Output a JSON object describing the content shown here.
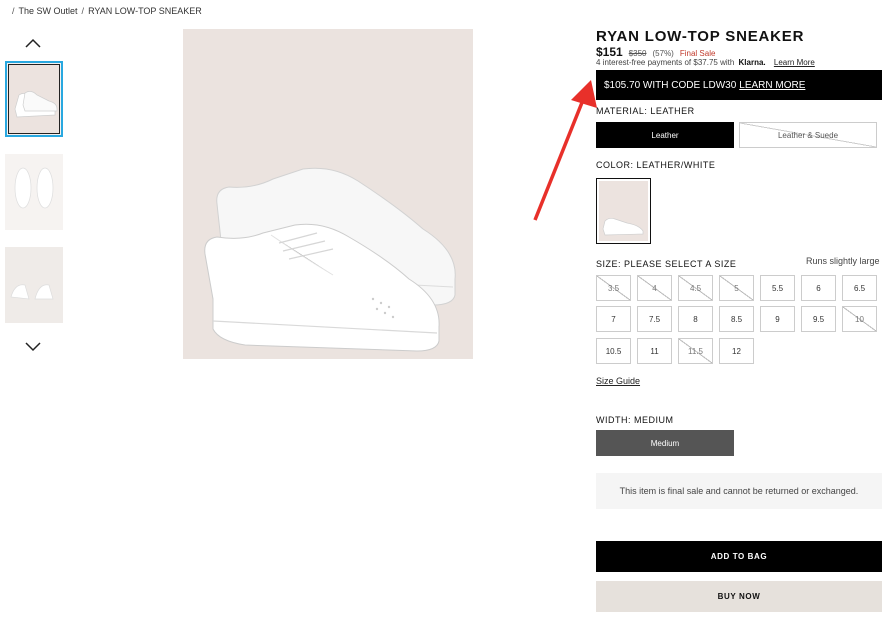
{
  "breadcrumb": {
    "items": [
      "The SW Outlet",
      "RYAN LOW-TOP SNEAKER"
    ]
  },
  "gallery": {
    "thumbnails": [
      "thumbnail-1",
      "thumbnail-2",
      "thumbnail-3"
    ],
    "active_index": 0,
    "up_icon": "chevron-up-icon",
    "down_icon": "chevron-down-icon"
  },
  "product": {
    "title": "RYAN LOW-TOP SNEAKER",
    "price": "$151",
    "original_price": "$350",
    "discount": "(57%)",
    "final_sale": "Final Sale",
    "klarna_text": "4 interest-free payments of $37.75 with",
    "klarna_brand": "Klarna.",
    "klarna_link": "Learn More"
  },
  "promo": {
    "text": "$105.70 WITH CODE LDW30",
    "link": "LEARN MORE"
  },
  "material": {
    "label": "MATERIAL: LEATHER",
    "options": [
      {
        "label": "Leather",
        "selected": true,
        "available": true
      },
      {
        "label": "Leather & Suede",
        "selected": false,
        "available": false
      }
    ]
  },
  "color": {
    "label": "COLOR: LEATHER/WHITE"
  },
  "size": {
    "label": "SIZE: PLEASE SELECT A SIZE",
    "fit_note": "Runs slightly large",
    "options": [
      {
        "label": "3.5",
        "available": false
      },
      {
        "label": "4",
        "available": false
      },
      {
        "label": "4.5",
        "available": false
      },
      {
        "label": "5",
        "available": false
      },
      {
        "label": "5.5",
        "available": true
      },
      {
        "label": "6",
        "available": true
      },
      {
        "label": "6.5",
        "available": true
      },
      {
        "label": "7",
        "available": true
      },
      {
        "label": "7.5",
        "available": true
      },
      {
        "label": "8",
        "available": true
      },
      {
        "label": "8.5",
        "available": true
      },
      {
        "label": "9",
        "available": true
      },
      {
        "label": "9.5",
        "available": true
      },
      {
        "label": "10",
        "available": false
      },
      {
        "label": "10.5",
        "available": true
      },
      {
        "label": "11",
        "available": true
      },
      {
        "label": "11.5",
        "available": false
      },
      {
        "label": "12",
        "available": true
      }
    ],
    "guide_link": "Size Guide"
  },
  "width": {
    "label": "WIDTH: MEDIUM",
    "selected": "Medium"
  },
  "notice": "This item is final sale and cannot be returned or exchanged.",
  "actions": {
    "add_to_bag": "ADD TO BAG",
    "buy_now": "BUY NOW"
  },
  "colors": {
    "promo_bg": "#000000",
    "final_sale": "#c0392b",
    "annotation_arrow": "#e8302a",
    "thumb_active_border": "#29a8e0",
    "image_bg": "#ebe3df"
  }
}
